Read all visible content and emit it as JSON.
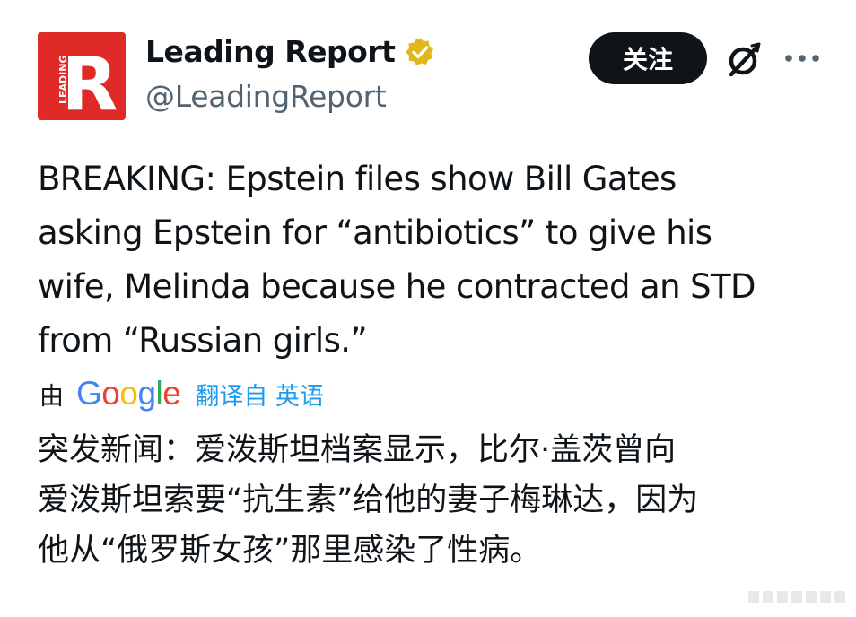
{
  "post": {
    "author": {
      "display_name": "Leading Report",
      "handle": "@LeadingReport",
      "avatar_letter": "R",
      "avatar_small_text": "LEADING",
      "avatar_color": "#e02a27",
      "verified_badge_color": "#e2b719"
    },
    "follow_label": "关注",
    "icons": {
      "grok": "grok-icon",
      "more": "more-icon",
      "verified": "verified-badge-icon"
    },
    "text": "BREAKING: Epstein files show Bill Gates\nasking Epstein for “antibiotics” to give his\nwife, Melinda because he contracted an STD\nfrom “Russian girls.”",
    "translation": {
      "by_label": "由",
      "provider_logo": [
        "G",
        "o",
        "o",
        "g",
        "l",
        "e"
      ],
      "provider_colors": [
        "#4285f4",
        "#ea4335",
        "#fbbc05",
        "#4285f4",
        "#34a853",
        "#ea4335"
      ],
      "link_label": "翻译自 英语",
      "text": "突发新闻：爱泼斯坦档案显示，比尔·盖茨曾向\n爱泼斯坦索要“抗生素”给他的妻子梅琳达，因为\n他从“俄罗斯女孩”那里感染了性病。"
    }
  },
  "colors": {
    "text_primary": "#0f1419",
    "text_secondary": "#536471",
    "link": "#1d9bf0",
    "button_bg": "#0f1419"
  }
}
